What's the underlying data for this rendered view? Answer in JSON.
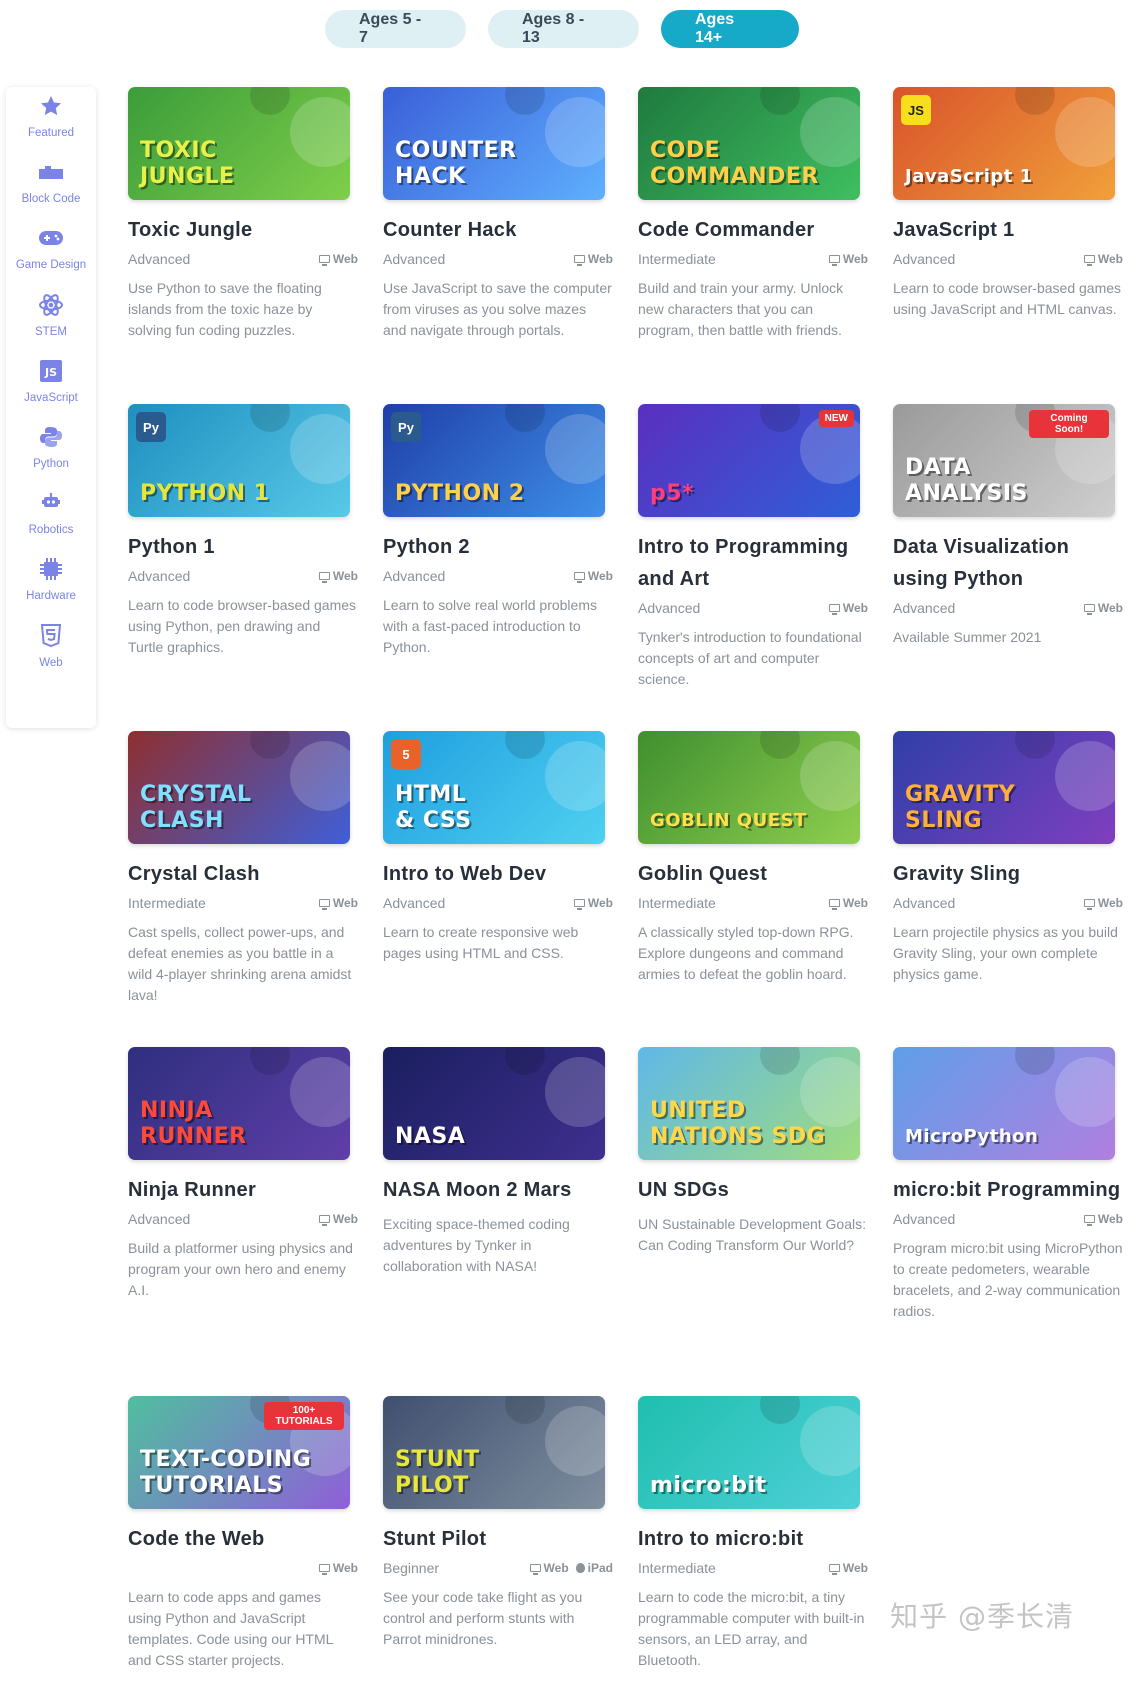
{
  "age_tabs": [
    {
      "label": "Ages 5 - 7",
      "active": false
    },
    {
      "label": "Ages 8 - 13",
      "active": false
    },
    {
      "label": "Ages 14+",
      "active": true
    }
  ],
  "sidebar": [
    {
      "label": "Featured",
      "icon": "star-icon"
    },
    {
      "label": "Block Code",
      "icon": "block-icon"
    },
    {
      "label": "Game Design",
      "icon": "gamepad-icon"
    },
    {
      "label": "STEM",
      "icon": "atom-icon"
    },
    {
      "label": "JavaScript",
      "icon": "js-icon"
    },
    {
      "label": "Python",
      "icon": "python-icon"
    },
    {
      "label": "Robotics",
      "icon": "robot-icon"
    },
    {
      "label": "Hardware",
      "icon": "chip-icon"
    },
    {
      "label": "Web",
      "icon": "html5-icon"
    }
  ],
  "courses": [
    {
      "title": "Toxic Jungle",
      "level": "Advanced",
      "platform": "Web",
      "desc": "Use Python to save the floating islands from the toxic haze by solving fun coding puzzles.",
      "thumb": "TOXIC\nJUNGLE",
      "colors": [
        "#3b9c3a",
        "#7fcf4a"
      ],
      "thumb_color": "#e8f04a"
    },
    {
      "title": "Counter Hack",
      "level": "Advanced",
      "platform": "Web",
      "desc": "Use JavaScript to save the computer from viruses as you solve mazes and navigate through portals.",
      "thumb": "COUNTER\nHACK",
      "colors": [
        "#3a5fd8",
        "#5fb0ff"
      ],
      "thumb_color": "#ffffff"
    },
    {
      "title": "Code Commander",
      "level": "Intermediate",
      "platform": "Web",
      "desc": "Build and train your army. Unlock new characters that you can program, then battle with friends.",
      "thumb": "CODE\nCOMMANDER",
      "colors": [
        "#1f7a3f",
        "#3fbf5f"
      ],
      "thumb_color": "#ffd04a"
    },
    {
      "title": "JavaScript 1",
      "level": "Advanced",
      "platform": "Web",
      "desc": "Learn to code browser-based games using JavaScript and HTML canvas.",
      "thumb": "JavaScript 1",
      "colors": [
        "#d9532b",
        "#f0a03a"
      ],
      "thumb_color": "#ffffff",
      "tag": "JS",
      "tag_color": "#f7df1e"
    },
    {
      "title": "Python 1",
      "level": "Advanced",
      "platform": "Web",
      "desc": "Learn to code browser-based games using Python, pen drawing and Turtle graphics.",
      "thumb": "PYTHON 1",
      "colors": [
        "#1e8fbf",
        "#59c9e8"
      ],
      "thumb_color": "#e6e63a",
      "tag": "Py",
      "tag_color": "#2b5a8f"
    },
    {
      "title": "Python 2",
      "level": "Advanced",
      "platform": "Web",
      "desc": "Learn to solve real world problems with a fast-paced introduction to Python.",
      "thumb": "PYTHON 2",
      "colors": [
        "#1f3fa8",
        "#3f8fe8"
      ],
      "thumb_color": "#ffd04a",
      "tag": "Py",
      "tag_color": "#2b5a8f"
    },
    {
      "title": "Intro to Programming and Art",
      "level": "Advanced",
      "platform": "Web",
      "desc": "Tynker's introduction to foundational concepts of art and computer science.",
      "thumb": "p5*",
      "colors": [
        "#5b2fbf",
        "#2f5fd8"
      ],
      "thumb_color": "#ff3d7f",
      "badge": "NEW"
    },
    {
      "title": "Data Visualization using Python",
      "level": "Advanced",
      "platform": "Web",
      "desc": "Available Summer 2021",
      "thumb": "DATA\nANALYSIS",
      "colors": [
        "#9a9a9a",
        "#cfcfcf"
      ],
      "thumb_color": "#ffffff",
      "badge": "Coming Soon!"
    },
    {
      "title": "Crystal Clash",
      "level": "Intermediate",
      "platform": "Web",
      "desc": "Cast spells, collect power-ups, and defeat enemies as you battle in a wild 4-player shrinking arena amidst lava!",
      "thumb": "CRYSTAL\nCLASH",
      "colors": [
        "#8f2f2f",
        "#3f5fd8"
      ],
      "thumb_color": "#7fe0ff"
    },
    {
      "title": "Intro to Web Dev",
      "level": "Advanced",
      "platform": "Web",
      "desc": "Learn to create responsive web pages using HTML and CSS.",
      "thumb": "HTML\n& CSS",
      "colors": [
        "#1f9fe0",
        "#4fd0f0"
      ],
      "thumb_color": "#ffffff",
      "tag": "5",
      "tag_color": "#e8622a"
    },
    {
      "title": "Goblin Quest",
      "level": "Intermediate",
      "platform": "Web",
      "desc": "A classically styled top-down RPG. Explore dungeons and command armies to defeat the goblin hoard.",
      "thumb": "GOBLIN QUEST",
      "colors": [
        "#3f8f2f",
        "#8fcf4f"
      ],
      "thumb_color": "#ffe04a"
    },
    {
      "title": "Gravity Sling",
      "level": "Advanced",
      "platform": "Web",
      "desc": "Learn projectile physics as you build Gravity Sling, your own complete physics game.",
      "thumb": "GRAVITY\nSLING",
      "colors": [
        "#2f3fa8",
        "#7f3fbf"
      ],
      "thumb_color": "#ffb03a"
    },
    {
      "title": "Ninja Runner",
      "level": "Advanced",
      "platform": "Web",
      "desc": "Build a platformer using physics and program your own hero and enemy A.I.",
      "thumb": "NINJA\nRUNNER",
      "colors": [
        "#2f2f7f",
        "#5f3fa8"
      ],
      "thumb_color": "#ff4a3a"
    },
    {
      "title": "NASA Moon 2 Mars",
      "level": "",
      "platform": "",
      "desc": "Exciting space-themed coding adventures by Tynker in collaboration with NASA!",
      "thumb": "NASA",
      "colors": [
        "#1a1f5f",
        "#3f2f8f"
      ],
      "thumb_color": "#ffffff"
    },
    {
      "title": "UN SDGs",
      "level": "",
      "platform": "",
      "desc": "UN Sustainable Development Goals: Can Coding Transform Our World?",
      "thumb": "UNITED\nNATIONS SDG",
      "colors": [
        "#5fb8e8",
        "#9fdc7f"
      ],
      "thumb_color": "#ffd84a"
    },
    {
      "title": "micro:bit Programming",
      "level": "Advanced",
      "platform": "Web",
      "desc": "Program micro:bit using MicroPython to create pedometers, wearable bracelets, and 2-way communication radios.",
      "thumb": "MicroPython",
      "colors": [
        "#5f9fe8",
        "#b07fe0"
      ],
      "thumb_color": "#ffffff"
    },
    {
      "title": "Code the Web",
      "level": "",
      "platform": "Web",
      "desc": "Learn to code apps and games using Python and JavaScript templates. Code using our HTML and CSS starter projects.",
      "thumb": "TEXT-CODING\nTUTORIALS",
      "colors": [
        "#4fbf9f",
        "#8f5fd8"
      ],
      "thumb_color": "#ffffff",
      "badge": "100+ TUTORIALS"
    },
    {
      "title": "Stunt Pilot",
      "level": "Beginner",
      "platform": "Web",
      "platform2": "iPad",
      "desc": "See your code take flight as you control and perform stunts with Parrot minidrones.",
      "thumb": "STUNT\nPILOT",
      "colors": [
        "#3f4f6f",
        "#7f8f9f"
      ],
      "thumb_color": "#e8e83a"
    },
    {
      "title": "Intro to micro:bit",
      "level": "Intermediate",
      "platform": "Web",
      "desc": "Learn to code the micro:bit, a tiny programmable computer with built-in sensors, an LED array, and Bluetooth.",
      "thumb": "micro:bit",
      "colors": [
        "#1fbfaf",
        "#4fd0d8"
      ],
      "thumb_color": "#ffffff"
    }
  ],
  "watermark": "知乎 @季长清"
}
